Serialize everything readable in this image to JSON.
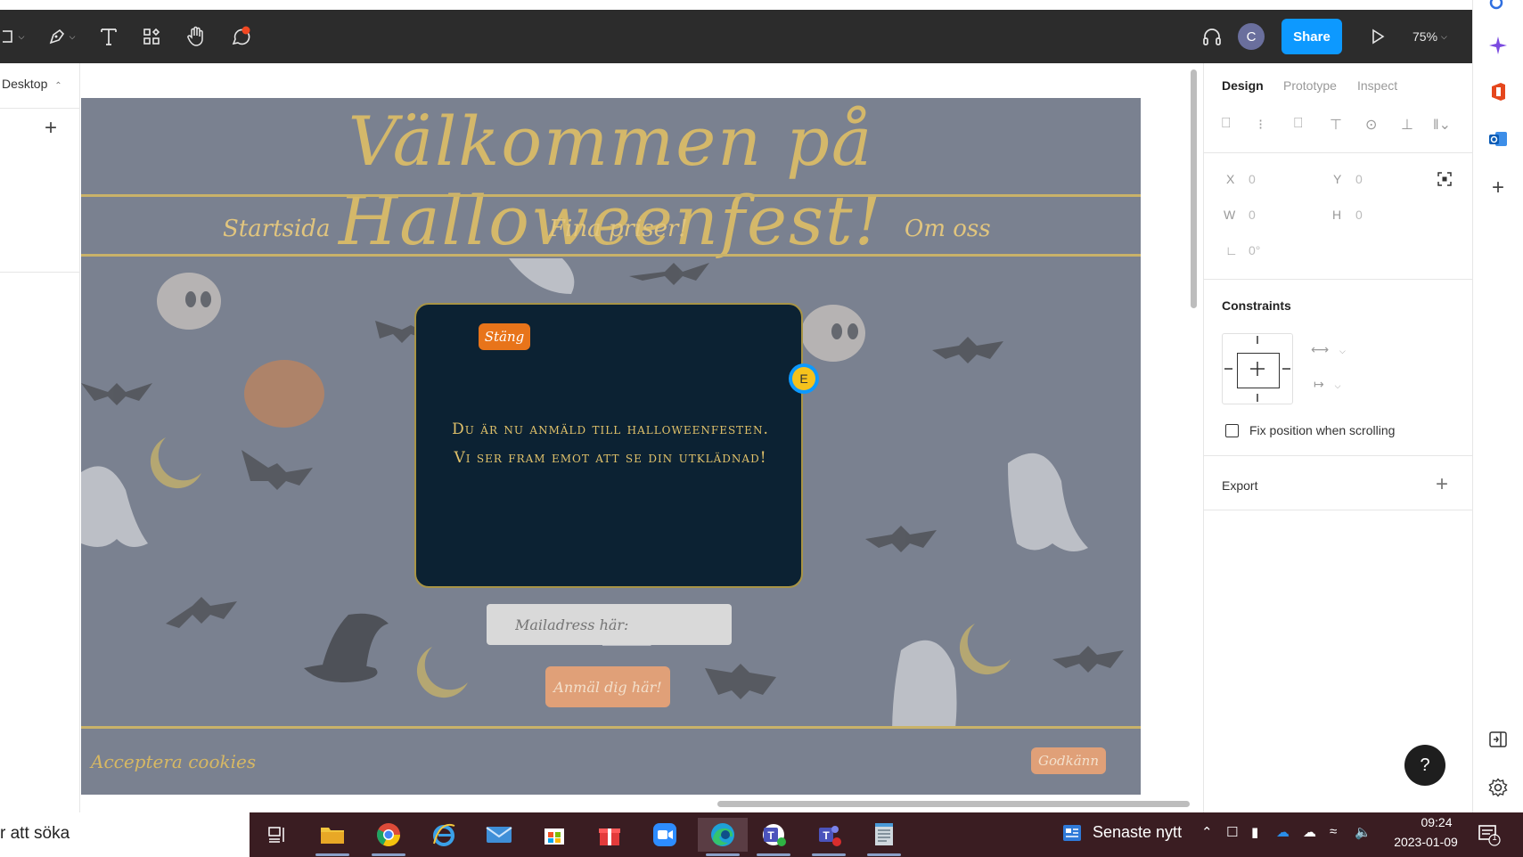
{
  "toolbar": {
    "zoom": "75%",
    "share_label": "Share",
    "avatar_initial": "C"
  },
  "left_panel": {
    "page_label": "Desktop",
    "add_label": "+"
  },
  "design_frame": {
    "title": "Välkommen på Halloweenfest!",
    "nav": [
      "Startsida",
      "Fina priser!",
      "Om oss"
    ],
    "modal": {
      "close_label": "Stäng",
      "line1": "Du är nu anmäld till halloweenfesten.",
      "line2": "Vi ser fram emot att se din utklädnad!"
    },
    "email_placeholder": "Mailadress här:",
    "signup_label": "Anmäl dig här!",
    "cookie_text": "Acceptera cookies",
    "accept_label": "Godkänn",
    "colors": {
      "background": "#7a8190",
      "gold": "#d4b86a",
      "modal": "#0c2233",
      "close_button": "#e8741a",
      "peach_button": "#e0a078"
    }
  },
  "collab_cursor": {
    "initial": "E"
  },
  "right_panel": {
    "tabs": [
      "Design",
      "Prototype",
      "Inspect"
    ],
    "active_tab": "Design",
    "props": {
      "x_label": "X",
      "x_value": "0",
      "y_label": "Y",
      "y_value": "0",
      "w_label": "W",
      "w_value": "0",
      "h_label": "H",
      "h_value": "0",
      "rotation_value": "0°"
    },
    "constraints_title": "Constraints",
    "fix_position_label": "Fix position when scrolling",
    "export_label": "Export",
    "help_label": "?"
  },
  "taskbar": {
    "search_text": "r att söka",
    "news_label": "Senaste nytt",
    "time": "09:24",
    "date": "2023-01-09",
    "notification_count": "1"
  }
}
